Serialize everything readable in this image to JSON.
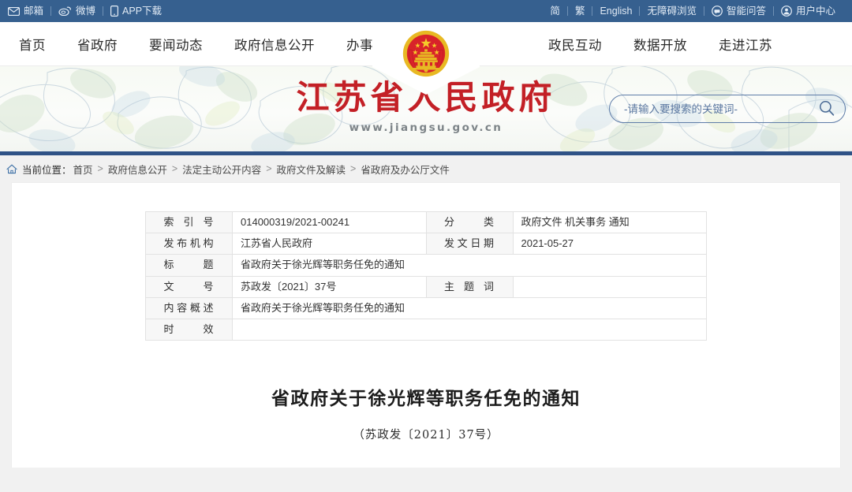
{
  "topbar": {
    "left_items": [
      {
        "label": "邮箱",
        "icon": "envelope-icon"
      },
      {
        "label": "微博",
        "icon": "weibo-icon"
      },
      {
        "label": "APP下载",
        "icon": "mobile-phone-icon"
      }
    ],
    "right_items": [
      {
        "label": "简",
        "icon": ""
      },
      {
        "label": "繁",
        "icon": ""
      },
      {
        "label": "English",
        "icon": ""
      },
      {
        "label": "无障碍浏览",
        "icon": ""
      },
      {
        "label": "智能问答",
        "icon": "chat-bubble-icon"
      },
      {
        "label": "用户中心",
        "icon": "user-circle-icon"
      }
    ]
  },
  "nav": {
    "left": [
      "首页",
      "省政府",
      "要闻动态",
      "政府信息公开",
      "办事服务"
    ],
    "right": [
      "政民互动",
      "数据开放",
      "走进江苏"
    ]
  },
  "banner": {
    "emblem": "national-emblem-icon",
    "title": "江苏省人民政府",
    "url": "www.jiangsu.gov.cn"
  },
  "search": {
    "placeholder": "-请输入要搜索的关键词-",
    "value": "",
    "icon": "search-icon"
  },
  "breadcrumb": {
    "home_icon": "home-icon",
    "label": "当前位置：",
    "items": [
      "首页",
      "政府信息公开",
      "法定主动公开内容",
      "政府文件及解读",
      "省政府及办公厅文件"
    ],
    "separator": ">"
  },
  "meta_table": {
    "rows": [
      {
        "label_left": "索 引 号",
        "value_left": "014000319/2021-00241",
        "label_right": "分　　类",
        "value_right": "政府文件 机关事务 通知"
      },
      {
        "label_left": "发布机构",
        "value_left": "江苏省人民政府",
        "label_right": "发文日期",
        "value_right": "2021-05-27"
      },
      {
        "label_left": "标　　题",
        "value_left": "省政府关于徐光辉等职务任免的通知",
        "label_right": null,
        "value_right": null
      },
      {
        "label_left": "文　　号",
        "value_left": "苏政发〔2021〕37号",
        "label_right": "主 题 词",
        "value_right": ""
      },
      {
        "label_left": "内容概述",
        "value_left": "省政府关于徐光辉等职务任免的通知",
        "label_right": null,
        "value_right": null
      },
      {
        "label_left": "时　　效",
        "value_left": "",
        "label_right": null,
        "value_right": null
      }
    ]
  },
  "document": {
    "title": "省政府关于徐光辉等职务任免的通知",
    "number": "（苏政发〔2021〕37号）"
  },
  "colors": {
    "topbar_blue": "#36608f",
    "rule_blue": "#2f5286",
    "brand_red": "#c32026",
    "page_bg": "#f1f1f1"
  }
}
